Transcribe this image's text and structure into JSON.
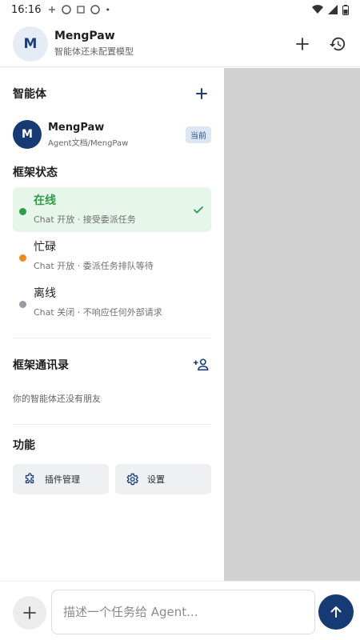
{
  "status_bar": {
    "time": "16:16",
    "extra": "•"
  },
  "header": {
    "avatar_letter": "M",
    "title": "MengPaw",
    "subtitle": "智能体还未配置模型"
  },
  "agents": {
    "title": "智能体",
    "current": {
      "avatar_letter": "M",
      "name": "MengPaw",
      "path": "Agent文档/MengPaw",
      "badge": "当前"
    }
  },
  "framework_status": {
    "title": "框架状态",
    "items": [
      {
        "label": "在线",
        "desc": "Chat 开放 · 接受委派任务",
        "color": "#2e9c46",
        "selected": true
      },
      {
        "label": "忙碌",
        "desc": "Chat 开放 · 委派任务排队等待",
        "color": "#ee8b1d",
        "selected": false
      },
      {
        "label": "离线",
        "desc": "Chat 关闭 · 不响应任何外部请求",
        "color": "#9a9aa2",
        "selected": false
      }
    ]
  },
  "contacts": {
    "title": "框架通讯录",
    "empty": "你的智能体还没有朋友"
  },
  "functions": {
    "title": "功能",
    "plugin_label": "插件管理",
    "settings_label": "设置"
  },
  "composer": {
    "placeholder": "描述一个任务给 Agent..."
  },
  "colors": {
    "accent": "#163a73",
    "online": "#2e9c46",
    "busy": "#ee8b1d",
    "offline": "#9a9aa2"
  }
}
